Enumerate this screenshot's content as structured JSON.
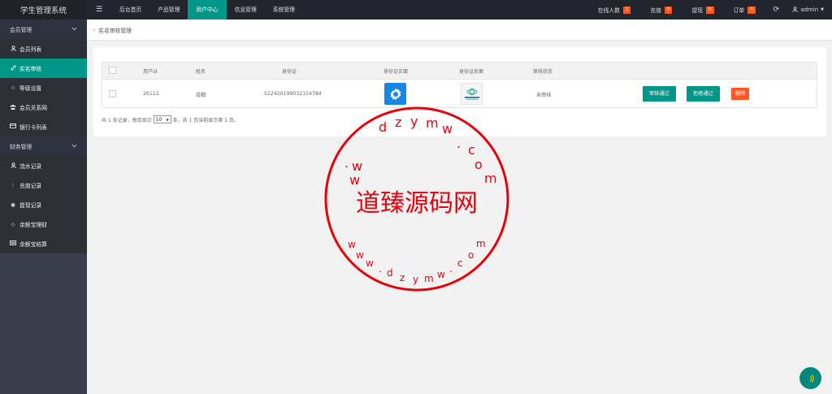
{
  "app": {
    "title": "学生管理系统"
  },
  "topnav": {
    "menu_icon": "menu-icon",
    "items": [
      {
        "label": "后台首页"
      },
      {
        "label": "产品管理"
      },
      {
        "label": "用户中心"
      },
      {
        "label": "信息管理"
      },
      {
        "label": "系统管理"
      }
    ],
    "active": "用户中心"
  },
  "topright": {
    "online": {
      "label": "在线人数",
      "count": "1"
    },
    "recharge": {
      "label": "充值",
      "count": "0"
    },
    "withdraw": {
      "label": "提现",
      "count": "0"
    },
    "orders": {
      "label": "订单",
      "count": "0"
    },
    "refresh_icon": "refresh-icon",
    "user": "admin"
  },
  "sidebar": {
    "groups": [
      {
        "label": "会员管理",
        "items": [
          {
            "label": "会员列表",
            "icon": "user-icon"
          },
          {
            "label": "实名审核",
            "icon": "link-icon"
          },
          {
            "label": "等级设置",
            "icon": "star-icon"
          },
          {
            "label": "会员关系网",
            "icon": "users-icon"
          },
          {
            "label": "银行卡列表",
            "icon": "card-icon"
          }
        ]
      },
      {
        "label": "财务管理",
        "items": [
          {
            "label": "流水记录",
            "icon": "user-icon"
          },
          {
            "label": "充值记录",
            "icon": "more-icon"
          },
          {
            "label": "提现记录",
            "icon": "circle-icon"
          },
          {
            "label": "余额宝理财",
            "icon": "diamond-icon"
          },
          {
            "label": "余额宝结算",
            "icon": "list-icon"
          }
        ]
      }
    ],
    "active_item": "实名审核"
  },
  "breadcrumb": {
    "current": "实名审核管理"
  },
  "table": {
    "headers": [
      "用户id",
      "姓名",
      "身份证",
      "身份证正面",
      "身份证反面",
      "审核状态"
    ],
    "rows": [
      {
        "id": "26112",
        "name": "成都",
        "idcard": "522420199032154784",
        "front_img": "gear-icon",
        "back_img": "china-mobile-logo",
        "status": "未审核",
        "actions": [
          "审核通过",
          "拒绝通过",
          "删除"
        ]
      }
    ]
  },
  "pager": {
    "prefix": "共 1 条记录，每页显示",
    "page_size": "10",
    "suffix": "条，共 1 页当前显示第 1 页。"
  },
  "watermark": {
    "center_text": "道臻源码网"
  },
  "colors": {
    "primary": "#009688",
    "danger": "#ff5722",
    "topbar": "#23262e",
    "sidebar": "#393d49",
    "stamp": "#e8000b"
  }
}
